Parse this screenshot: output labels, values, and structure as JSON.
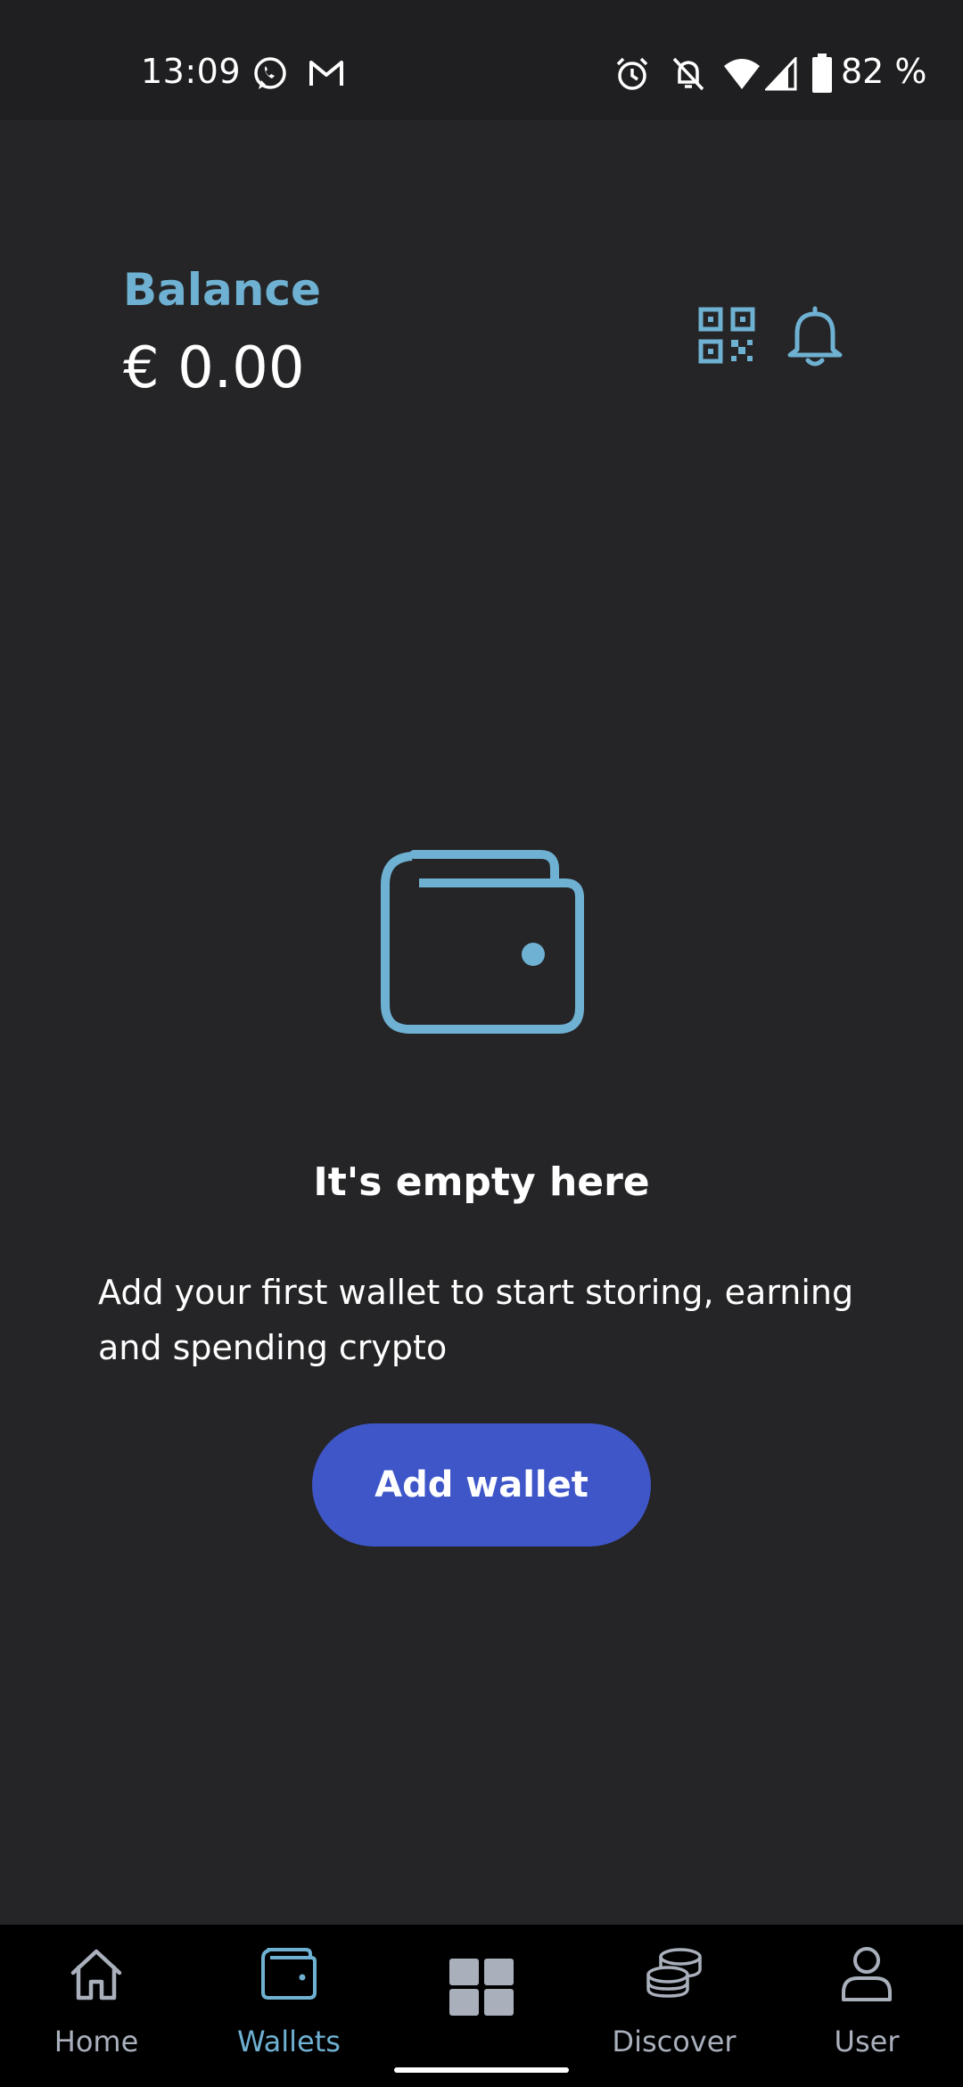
{
  "status_bar": {
    "time": "13:09",
    "battery_percent": "82 %",
    "icons": [
      "whatsapp-icon",
      "gmail-icon",
      "alarm-icon",
      "notifications-off-icon",
      "wifi-icon",
      "signal-icon",
      "battery-icon"
    ]
  },
  "header": {
    "balance_label": "Balance",
    "balance_value": "€ 0.00",
    "actions": [
      "qr-code-icon",
      "bell-icon"
    ]
  },
  "empty_state": {
    "title": "It's empty here",
    "description": "Add your first wallet to start storing, earning and spending crypto",
    "button_label": "Add wallet"
  },
  "bottom_nav": {
    "items": [
      {
        "label": "Home",
        "icon": "home-icon",
        "active": false
      },
      {
        "label": "Wallets",
        "icon": "wallet-icon",
        "active": true
      },
      {
        "label": "",
        "icon": "grid-icon",
        "active": false
      },
      {
        "label": "Discover",
        "icon": "coins-icon",
        "active": false
      },
      {
        "label": "User",
        "icon": "user-icon",
        "active": false
      }
    ]
  },
  "colors": {
    "background": "#252527",
    "accent": "#6fb1d2",
    "button": "#3f56c9",
    "nav_background": "#000000",
    "nav_inactive": "#a9b0bc"
  }
}
